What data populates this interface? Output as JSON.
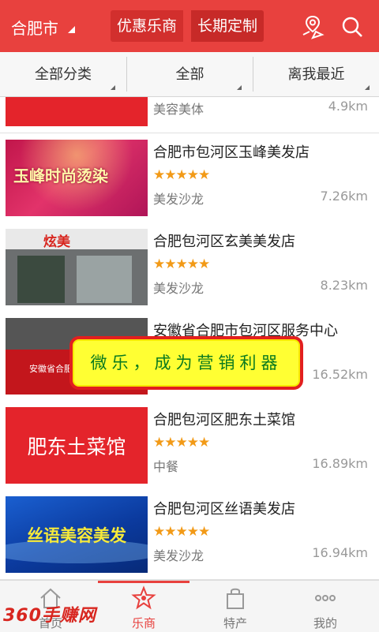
{
  "header": {
    "city": "合肥市",
    "tabs": [
      {
        "label": "优惠乐商",
        "active": true
      },
      {
        "label": "长期定制",
        "active": false
      }
    ],
    "icons": [
      "location-icon",
      "search-icon"
    ],
    "accent": "#e8413e"
  },
  "filters": [
    {
      "label": "全部分类"
    },
    {
      "label": "全部"
    },
    {
      "label": "离我最近"
    }
  ],
  "list": [
    {
      "name": "",
      "stars": "",
      "category": "美容美体",
      "distance": "4.9km",
      "thumb_text": ""
    },
    {
      "name": "合肥市包河区玉峰美发店",
      "stars": "★★★★★",
      "category": "美发沙龙",
      "distance": "7.26km",
      "thumb_text": "玉峰时尚烫染"
    },
    {
      "name": "合肥包河区玄美美发店",
      "stars": "★★★★★",
      "category": "美发沙龙",
      "distance": "8.23km",
      "thumb_text": "炫美"
    },
    {
      "name": "安徽省合肥市包河区服务中心",
      "stars": "★★★★★",
      "category": "",
      "distance": "16.52km",
      "thumb_text": "安徽省合肥"
    },
    {
      "name": "合肥包河区肥东土菜馆",
      "stars": "★★★★★",
      "category": "中餐",
      "distance": "16.89km",
      "thumb_text": "肥东土菜馆"
    },
    {
      "name": "合肥包河区丝语美发店",
      "stars": "★★★★★",
      "category": "美发沙龙",
      "distance": "16.94km",
      "thumb_text": "丝语美容美发"
    }
  ],
  "banner": {
    "text": "微乐，成为营销利器"
  },
  "bottom_nav": [
    {
      "label": "首页",
      "icon": "home-icon",
      "active": false
    },
    {
      "label": "乐商",
      "icon": "star-icon",
      "active": true
    },
    {
      "label": "特产",
      "icon": "bag-icon",
      "active": false
    },
    {
      "label": "我的",
      "icon": "more-icon",
      "active": false
    }
  ],
  "watermark": "360手赚网"
}
